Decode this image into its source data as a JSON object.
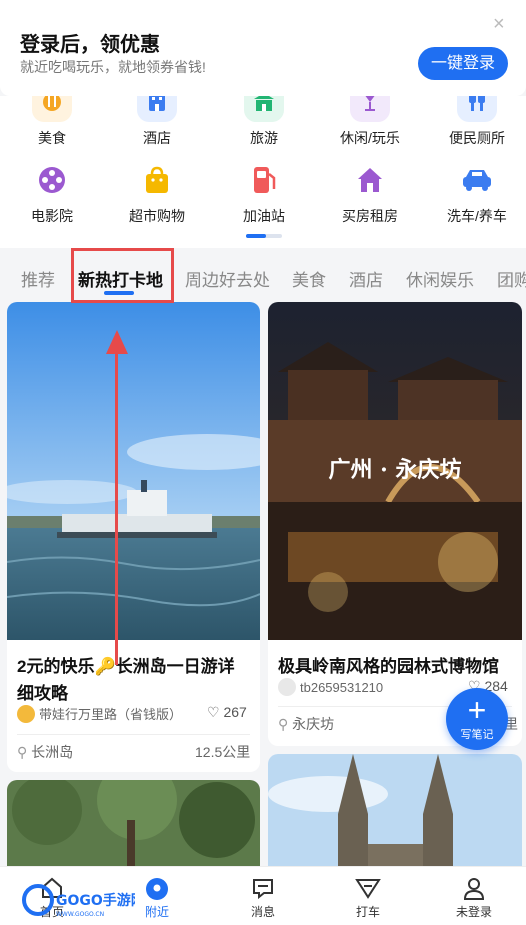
{
  "login_banner": {
    "title": "登录后，领优惠",
    "subtitle": "就近吃喝玩乐，就地领券省钱!",
    "button": "一键登录",
    "close": "×"
  },
  "categories": [
    {
      "label": "美食",
      "icon": "food-icon",
      "color": "#f5a623"
    },
    {
      "label": "酒店",
      "icon": "hotel-icon",
      "color": "#3b7cf0"
    },
    {
      "label": "旅游",
      "icon": "travel-icon",
      "color": "#22b573"
    },
    {
      "label": "休闲/玩乐",
      "icon": "leisure-icon",
      "color": "#9b59d0"
    },
    {
      "label": "便民厕所",
      "icon": "toilet-icon",
      "color": "#3b7cf0"
    },
    {
      "label": "电影院",
      "icon": "cinema-icon",
      "color": "#9b59d0"
    },
    {
      "label": "超市购物",
      "icon": "shopping-bag-icon",
      "color": "#f5b800"
    },
    {
      "label": "加油站",
      "icon": "gas-station-icon",
      "color": "#f05a5a"
    },
    {
      "label": "买房租房",
      "icon": "house-icon",
      "color": "#9b59d0"
    },
    {
      "label": "洗车/养车",
      "icon": "car-icon",
      "color": "#3b7cf0"
    }
  ],
  "tabs": [
    "推荐",
    "新热打卡地",
    "周边好去处",
    "美食",
    "酒店",
    "休闲娱乐",
    "团购"
  ],
  "active_tab": "新热打卡地",
  "cards": [
    {
      "title": "2元的快乐🔑长洲岛一日游详细攻略",
      "author": "带娃行万里路（省钱版）",
      "likes": "267",
      "location": "长洲岛",
      "distance": "12.5公里"
    },
    {
      "title": "极具岭南风格的园林式博物馆",
      "image_text": "广州 · 永庆坊",
      "author": "tb2659531210",
      "likes": "284",
      "location": "永庆坊",
      "distance": "里"
    }
  ],
  "fab_label": "写笔记",
  "bottom_nav": [
    {
      "label": "首页",
      "icon": "home-icon"
    },
    {
      "label": "附近",
      "icon": "location-icon"
    },
    {
      "label": "消息",
      "icon": "message-icon"
    },
    {
      "label": "打车",
      "icon": "taxi-icon"
    },
    {
      "label": "未登录",
      "icon": "user-icon"
    }
  ],
  "watermark": "GOGO手游网",
  "watermark_url": "WWW.GOGO.CN",
  "colors": {
    "accent": "#1f6ff2",
    "highlight": "#e64a4a"
  }
}
